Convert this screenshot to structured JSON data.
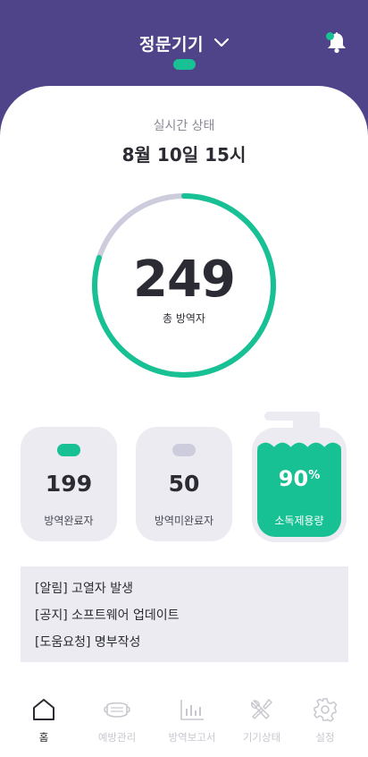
{
  "header": {
    "device_name": "정문기기"
  },
  "status": {
    "label": "실시간 상태",
    "time": "8월 10일 15시"
  },
  "gauge": {
    "total": "249",
    "label": "총 방역자",
    "completed_fraction": 0.8,
    "color_complete": "#17c194",
    "color_remaining": "#cdccdd"
  },
  "stats": [
    {
      "value": "199",
      "label": "방역완료자",
      "pill_color": "#17c194"
    },
    {
      "value": "50",
      "label": "방역미완료자",
      "pill_color": "#cdccdd"
    }
  ],
  "sanitizer": {
    "value": "90",
    "unit": "%",
    "label": "소독제용량",
    "level_fraction": 0.9
  },
  "notices": [
    "[알림] 고열자 발생",
    "[공지] 소프트웨어 업데이트",
    "[도움요청] 명부작성"
  ],
  "nav": [
    {
      "label": "홈",
      "icon": "home-icon",
      "active": true
    },
    {
      "label": "예방관리",
      "icon": "mask-icon",
      "active": false
    },
    {
      "label": "방역보고서",
      "icon": "bar-chart-icon",
      "active": false
    },
    {
      "label": "기기상태",
      "icon": "tools-icon",
      "active": false
    },
    {
      "label": "설정",
      "icon": "gear-icon",
      "active": false
    }
  ],
  "colors": {
    "header_bg": "#4f4489",
    "accent": "#17c194",
    "panel_bg": "#ebebf1"
  }
}
